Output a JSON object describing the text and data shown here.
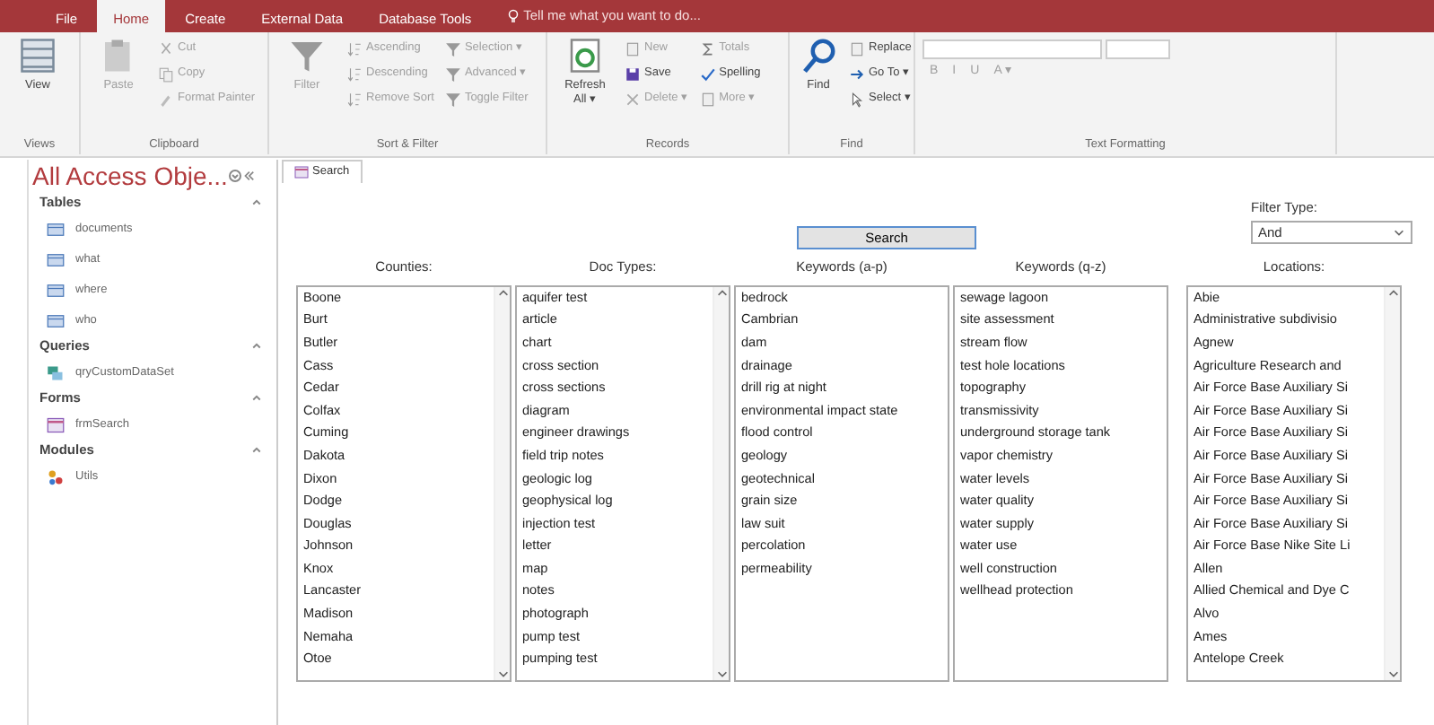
{
  "ribbon": {
    "tabs": [
      {
        "label": "File",
        "selected": false
      },
      {
        "label": "Home",
        "selected": true
      },
      {
        "label": "Create",
        "selected": false
      },
      {
        "label": "External Data",
        "selected": false
      },
      {
        "label": "Database Tools",
        "selected": false
      }
    ],
    "tell_me": "Tell me what you want to do...",
    "groups": [
      {
        "label": "Views",
        "items": [
          {
            "kind": "large",
            "label": "View",
            "disabled": false
          }
        ]
      },
      {
        "label": "Clipboard",
        "items": [
          {
            "kind": "large",
            "label": "Paste",
            "disabled": true
          },
          {
            "kind": "small",
            "label": "Cut",
            "disabled": true
          },
          {
            "kind": "small",
            "label": "Copy",
            "disabled": true
          },
          {
            "kind": "small",
            "label": "Format Painter",
            "disabled": true
          }
        ]
      },
      {
        "label": "Sort & Filter",
        "items": [
          {
            "kind": "large",
            "label": "Filter",
            "disabled": true
          },
          {
            "kind": "small",
            "label": "Ascending",
            "disabled": true
          },
          {
            "kind": "small",
            "label": "Descending",
            "disabled": true
          },
          {
            "kind": "small",
            "label": "Remove Sort",
            "disabled": true
          },
          {
            "kind": "small",
            "label": "Selection ▾",
            "disabled": true
          },
          {
            "kind": "small",
            "label": "Advanced ▾",
            "disabled": true
          },
          {
            "kind": "small",
            "label": "Toggle Filter",
            "disabled": true
          }
        ]
      },
      {
        "label": "Records",
        "items": [
          {
            "kind": "large",
            "label": "Refresh All ▾",
            "disabled": false
          },
          {
            "kind": "small",
            "label": "New",
            "disabled": true
          },
          {
            "kind": "small",
            "label": "Save",
            "disabled": false
          },
          {
            "kind": "small",
            "label": "Delete ▾",
            "disabled": true
          },
          {
            "kind": "small",
            "label": "Totals",
            "disabled": true
          },
          {
            "kind": "small",
            "label": "Spelling",
            "disabled": false
          },
          {
            "kind": "small",
            "label": "More ▾",
            "disabled": true
          }
        ]
      },
      {
        "label": "Find",
        "items": [
          {
            "kind": "large",
            "label": "Find",
            "disabled": false
          },
          {
            "kind": "small",
            "label": "Replace",
            "disabled": false
          },
          {
            "kind": "small",
            "label": "Go To ▾",
            "disabled": false
          },
          {
            "kind": "small",
            "label": "Select ▾",
            "disabled": false
          }
        ]
      },
      {
        "label": "Text Formatting",
        "items": [
          {
            "kind": "format",
            "label": "B",
            "disabled": true
          },
          {
            "kind": "format",
            "label": "I",
            "disabled": true
          },
          {
            "kind": "format",
            "label": "U",
            "disabled": true
          },
          {
            "kind": "format",
            "label": "A ▾",
            "disabled": true
          }
        ]
      }
    ]
  },
  "nav_pane": {
    "title": "All Access Obje...",
    "sections": [
      {
        "label": "Tables",
        "items": [
          {
            "label": "documents",
            "kind": "table"
          },
          {
            "label": "what",
            "kind": "table"
          },
          {
            "label": "where",
            "kind": "table"
          },
          {
            "label": "who",
            "kind": "table"
          }
        ]
      },
      {
        "label": "Queries",
        "items": [
          {
            "label": "qryCustomDataSet",
            "kind": "query"
          }
        ]
      },
      {
        "label": "Forms",
        "items": [
          {
            "label": "frmSearch",
            "kind": "form"
          }
        ]
      },
      {
        "label": "Modules",
        "items": [
          {
            "label": "Utils",
            "kind": "module"
          }
        ]
      }
    ]
  },
  "document_tab": {
    "label": "Search"
  },
  "form": {
    "search_button": "Search",
    "filter_type": {
      "label": "Filter Type:",
      "value": "And"
    },
    "lists": [
      {
        "heading": "Counties:",
        "scrollable": true,
        "items": [
          "Boone",
          "Burt",
          "Butler",
          "Cass",
          "Cedar",
          "Colfax",
          "Cuming",
          "Dakota",
          "Dixon",
          "Dodge",
          "Douglas",
          "Johnson",
          "Knox",
          "Lancaster",
          "Madison",
          "Nemaha",
          "Otoe"
        ]
      },
      {
        "heading": "Doc Types:",
        "scrollable": true,
        "items": [
          "aquifer test",
          "article",
          "chart",
          "cross section",
          "cross sections",
          "diagram",
          "engineer drawings",
          "field trip notes",
          "geologic log",
          "geophysical log",
          "injection test",
          "letter",
          "map",
          "notes",
          "photograph",
          "pump test",
          "pumping test"
        ]
      },
      {
        "heading": "Keywords (a-p)",
        "scrollable": false,
        "items": [
          "bedrock",
          "Cambrian",
          "dam",
          "drainage",
          "drill rig at night",
          "environmental impact state",
          "flood control",
          "geology",
          "geotechnical",
          "grain size",
          "law suit",
          "percolation",
          "permeability"
        ]
      },
      {
        "heading": "Keywords (q-z)",
        "scrollable": false,
        "items": [
          "sewage lagoon",
          "site assessment",
          "stream flow",
          "test hole locations",
          "topography",
          "transmissivity",
          "underground storage tank",
          "vapor chemistry",
          "water levels",
          "water quality",
          "water supply",
          "water use",
          "well construction",
          "wellhead protection"
        ]
      },
      {
        "heading": "Locations:",
        "scrollable": true,
        "items": [
          "Abie",
          "Administrative subdivisio",
          "Agnew",
          "Agriculture Research and",
          "Air Force Base Auxiliary Si",
          "Air Force Base Auxiliary Si",
          "Air Force Base Auxiliary Si",
          "Air Force Base Auxiliary Si",
          "Air Force Base Auxiliary Si",
          "Air Force Base Auxiliary Si",
          "Air Force Base Auxiliary Si",
          "Air Force Base Nike Site Li",
          "Allen",
          "Allied Chemical and Dye C",
          "Alvo",
          "Ames",
          "Antelope Creek"
        ]
      }
    ]
  }
}
